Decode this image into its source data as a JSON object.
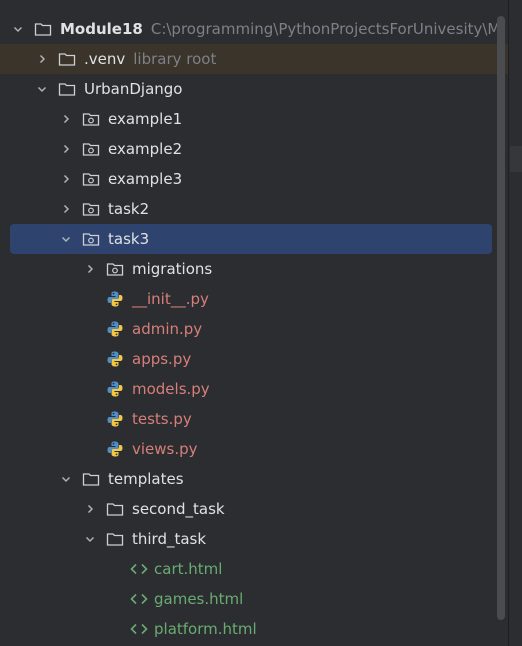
{
  "project_tree": {
    "root": {
      "label": "Module18",
      "path": "C:\\programming\\PythonProjectsForUnivesity\\M"
    },
    "venv": {
      "label": ".venv",
      "hint": "library root"
    },
    "urban": {
      "label": "UrbanDjango"
    },
    "example1": {
      "label": "example1"
    },
    "example2": {
      "label": "example2"
    },
    "example3": {
      "label": "example3"
    },
    "task2": {
      "label": "task2"
    },
    "task3": {
      "label": "task3"
    },
    "migrations": {
      "label": "migrations"
    },
    "init": {
      "label": "__init__.py"
    },
    "admin": {
      "label": "admin.py"
    },
    "apps": {
      "label": "apps.py"
    },
    "models": {
      "label": "models.py"
    },
    "tests": {
      "label": "tests.py"
    },
    "views": {
      "label": "views.py"
    },
    "templates": {
      "label": "templates"
    },
    "second_task": {
      "label": "second_task"
    },
    "third_task": {
      "label": "third_task"
    },
    "cart": {
      "label": "cart.html"
    },
    "games": {
      "label": "games.html"
    },
    "platform": {
      "label": "platform.html"
    }
  },
  "colors": {
    "background": "#2b2d30",
    "selection": "#2e436e",
    "excluded_row": "#3a342a",
    "python_file": "#d67f7a",
    "html_file": "#6aab73"
  }
}
